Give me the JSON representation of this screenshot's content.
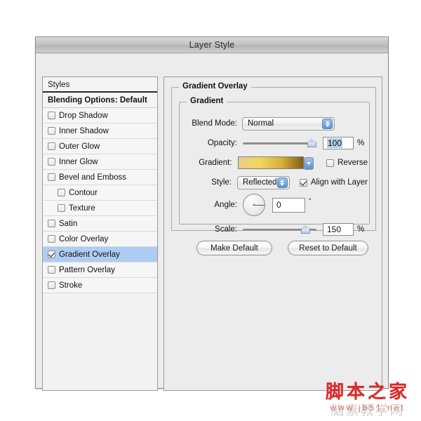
{
  "window": {
    "title": "Layer Style"
  },
  "styles_panel": {
    "header": "Styles",
    "blending_options": "Blending Options: Default",
    "items": [
      {
        "label": "Drop Shadow",
        "checked": false,
        "indent": false,
        "selected": false
      },
      {
        "label": "Inner Shadow",
        "checked": false,
        "indent": false,
        "selected": false
      },
      {
        "label": "Outer Glow",
        "checked": false,
        "indent": false,
        "selected": false
      },
      {
        "label": "Inner Glow",
        "checked": false,
        "indent": false,
        "selected": false
      },
      {
        "label": "Bevel and Emboss",
        "checked": false,
        "indent": false,
        "selected": false
      },
      {
        "label": "Contour",
        "checked": false,
        "indent": true,
        "selected": false
      },
      {
        "label": "Texture",
        "checked": false,
        "indent": true,
        "selected": false
      },
      {
        "label": "Satin",
        "checked": false,
        "indent": false,
        "selected": false
      },
      {
        "label": "Color Overlay",
        "checked": false,
        "indent": false,
        "selected": false
      },
      {
        "label": "Gradient Overlay",
        "checked": true,
        "indent": false,
        "selected": true
      },
      {
        "label": "Pattern Overlay",
        "checked": false,
        "indent": false,
        "selected": false
      },
      {
        "label": "Stroke",
        "checked": false,
        "indent": false,
        "selected": false
      }
    ]
  },
  "panel": {
    "outer_group_title": "Gradient Overlay",
    "inner_group_title": "Gradient",
    "blend_mode": {
      "label": "Blend Mode:",
      "value": "Normal"
    },
    "opacity": {
      "label": "Opacity:",
      "value": "100",
      "unit": "%",
      "percent": 100
    },
    "gradient": {
      "label": "Gradient:",
      "stops": [
        "#e6d08c",
        "#f2d55c",
        "#d8ae3a",
        "#7d5f16"
      ],
      "reverse_label": "Reverse",
      "reverse_checked": false
    },
    "style": {
      "label": "Style:",
      "value": "Reflected",
      "align_label": "Align with Layer",
      "align_checked": true
    },
    "angle": {
      "label": "Angle:",
      "value": "0",
      "unit": "°",
      "degrees": 0
    },
    "scale": {
      "label": "Scale:",
      "value": "150",
      "unit": "%",
      "percent": 90
    },
    "buttons": {
      "make_default": "Make Default",
      "reset_to_default": "Reset to Default"
    }
  },
  "watermark": {
    "chinese": "脚本之家",
    "url": "www.jb51.net",
    "ghost": "脑素教学网"
  },
  "colors": {
    "accent_blue": "#aecdf2",
    "stepper_blue": "#5f93d6",
    "watermark_red": "#d92b2b"
  }
}
